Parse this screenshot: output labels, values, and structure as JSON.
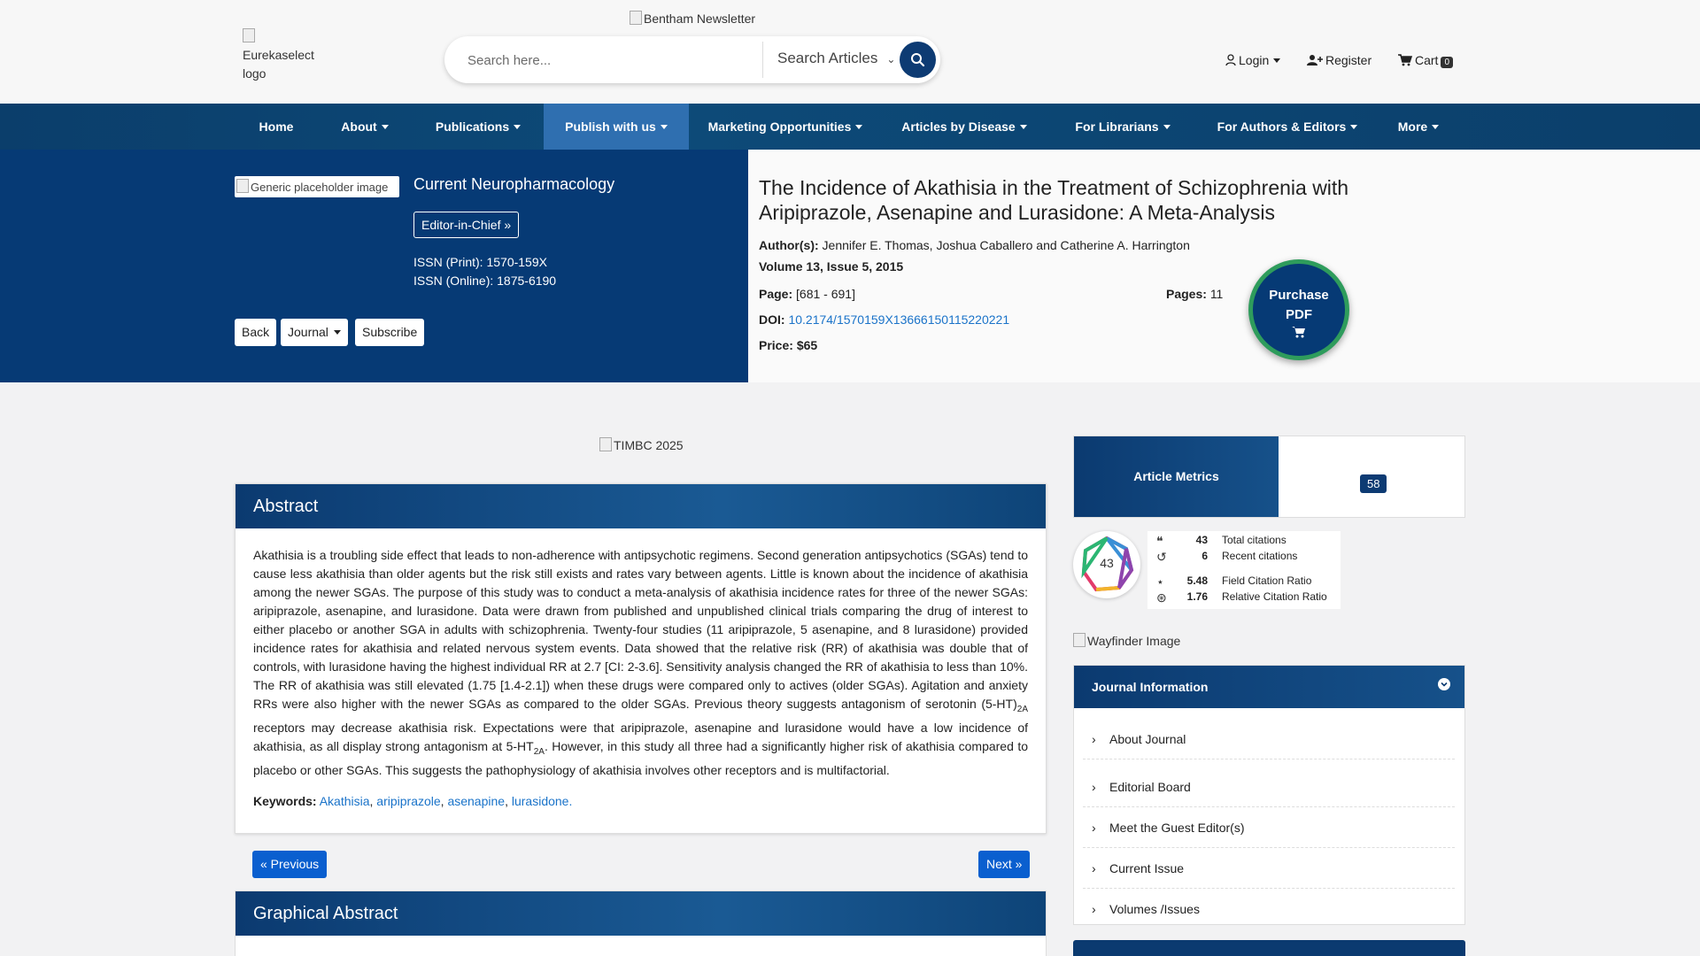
{
  "header": {
    "logo_alt": "Eurekaselect logo",
    "newsletter_alt": "Bentham Newsletter",
    "search": {
      "placeholder": "Search here...",
      "scope": "Search Articles"
    },
    "login": "Login",
    "register": "Register",
    "cart": "Cart",
    "cart_count": "0"
  },
  "nav": {
    "items": [
      {
        "label": "Home"
      },
      {
        "label": "About"
      },
      {
        "label": "Publications"
      },
      {
        "label": "Publish with us"
      },
      {
        "label": "Marketing Opportunities"
      },
      {
        "label": "Articles by Disease"
      },
      {
        "label": "For Librarians"
      },
      {
        "label": "For Authors & Editors"
      },
      {
        "label": "More"
      }
    ]
  },
  "journal": {
    "cover_alt": "Generic placeholder image",
    "name": "Current Neuropharmacology",
    "editor_btn": "Editor-in-Chief",
    "issn_print": "ISSN (Print): 1570-159X",
    "issn_online": "ISSN (Online): 1875-6190",
    "back": "Back",
    "journal_btn": "Journal",
    "subscribe": "Subscribe"
  },
  "article": {
    "title": "The Incidence of Akathisia in the Treatment of Schizophrenia with Aripiprazole, Asenapine and Lurasidone: A Meta-Analysis",
    "authors_label": "Author(s):",
    "authors": "Jennifer E. Thomas, Joshua Caballero and Catherine A. Harrington",
    "volume": "Volume 13, Issue 5, 2015",
    "page_label": "Page:",
    "page": "[681 - 691]",
    "pages_label": "Pages:",
    "pages": "11",
    "doi_label": "DOI:",
    "doi": "10.2174/1570159X13666150115220221",
    "price_label": "Price:",
    "price": "$65",
    "purchase_line1": "Purchase",
    "purchase_line2": "PDF"
  },
  "main": {
    "banner_alt": "TIMBC 2025",
    "abstract_title": "Abstract",
    "abstract_p1": "Akathisia is a troubling side effect that leads to non-adherence with antipsychotic regimens. Second generation antipsychotics (SGAs) tend to cause less akathisia than older agents but the risk still exists and rates vary between agents. Little is known about the incidence of akathisia among the newer SGAs. The purpose of this study was to conduct a meta-analysis of akathisia incidence rates for three of the newer SGAs: aripiprazole, asenapine, and lurasidone. Data were drawn from published and unpublished clinical trials comparing the drug of interest to either placebo or another SGA in adults with schizophrenia. Twenty-four studies (11 aripiprazole, 5 asenapine, and 8 lurasidone) provided incidence rates for akathisia and related nervous system events. Data showed that the relative risk (RR) of akathisia was double that of controls, with lurasidone having the highest individual RR at 2.7 [CI: 2-3.6]. Sensitivity analysis changed the RR of akathisia to less than 10%. The RR of akathisia was still elevated (1.75 [1.4-2.1]) when these drugs were compared only to actives (older SGAs). Agitation and anxiety RRs were also higher with the newer SGAs as compared to the older SGAs. Previous theory suggests antagonism of serotonin (5-HT)",
    "sub1": "2A",
    "abstract_p2": " receptors may decrease akathisia risk. Expectations were that aripiprazole, asenapine and lurasidone would have a low incidence of akathisia, as all display strong antagonism at 5-HT",
    "sub2": "2A",
    "abstract_p3": ". However, in this study all three had a significantly higher risk of akathisia compared to placebo or other SGAs. This suggests the pathophysiology of akathisia involves other receptors and is multifactorial.",
    "keywords_label": "Keywords:",
    "keywords": [
      "Akathisia",
      "aripiprazole",
      "asenapine",
      "lurasidone."
    ],
    "prev": "« Previous",
    "next": "Next »",
    "graphical_title": "Graphical Abstract"
  },
  "sidebar": {
    "metrics_title": "Article Metrics",
    "metrics_count": "58",
    "dimensions_score": "43",
    "citations": [
      {
        "value": "43",
        "label": "Total citations"
      },
      {
        "value": "6",
        "label": "Recent citations"
      },
      {
        "value": "5.48",
        "label": "Field Citation Ratio"
      },
      {
        "value": "1.76",
        "label": "Relative Citation Ratio"
      }
    ],
    "wayfinder_alt": "Wayfinder Image",
    "journal_info_title": "Journal Information",
    "journal_info_items": [
      {
        "label": "About Journal"
      },
      {
        "label": "Editorial Board"
      },
      {
        "label": "Meet the Guest Editor(s)"
      },
      {
        "label": "Current Issue"
      },
      {
        "label": "Volumes /Issues"
      }
    ]
  },
  "colors": {
    "brand_navy": "#063a75",
    "nav_active": "#2f6fb0",
    "link": "#1a73c9",
    "purchase_ring": "#2e9c5c"
  }
}
